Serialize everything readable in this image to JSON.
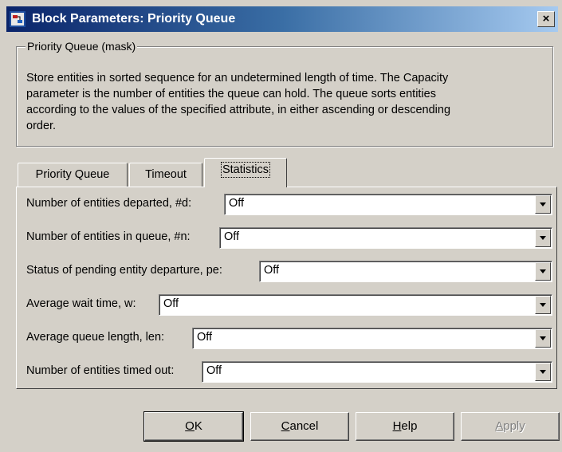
{
  "window": {
    "title": "Block Parameters: Priority Queue",
    "close_glyph": "×"
  },
  "mask": {
    "legend": "Priority Queue (mask)",
    "description_lines": [
      "Store entities in sorted sequence for an undetermined length of time. The Capacity",
      "parameter is the number of entities the queue can hold. The queue sorts entities",
      "according to the values of the specified attribute, in either ascending or descending",
      "order."
    ]
  },
  "tabs": [
    {
      "label": "Priority Queue",
      "active": false
    },
    {
      "label": "Timeout",
      "active": false
    },
    {
      "label": "Statistics",
      "active": true
    }
  ],
  "statistics": {
    "rows": [
      {
        "label": "Number of entities departed, #d:",
        "value": "Off"
      },
      {
        "label": "Number of entities in queue, #n:",
        "value": "Off"
      },
      {
        "label": "Status of pending entity departure, pe:",
        "value": "Off"
      },
      {
        "label": "Average wait time, w:",
        "value": "Off"
      },
      {
        "label": "Average queue length, len:",
        "value": "Off"
      },
      {
        "label": "Number of entities timed out:",
        "value": "Off"
      }
    ]
  },
  "buttons": {
    "ok": {
      "mnemonic": "O",
      "rest": "K"
    },
    "cancel": {
      "mnemonic": "C",
      "rest": "ancel"
    },
    "help": {
      "mnemonic": "H",
      "rest": "elp"
    },
    "apply": {
      "mnemonic": "A",
      "rest": "pply"
    }
  },
  "icons": {
    "app": "simulink-block-icon",
    "close": "close-icon",
    "dropdown": "chevron-down-icon"
  }
}
